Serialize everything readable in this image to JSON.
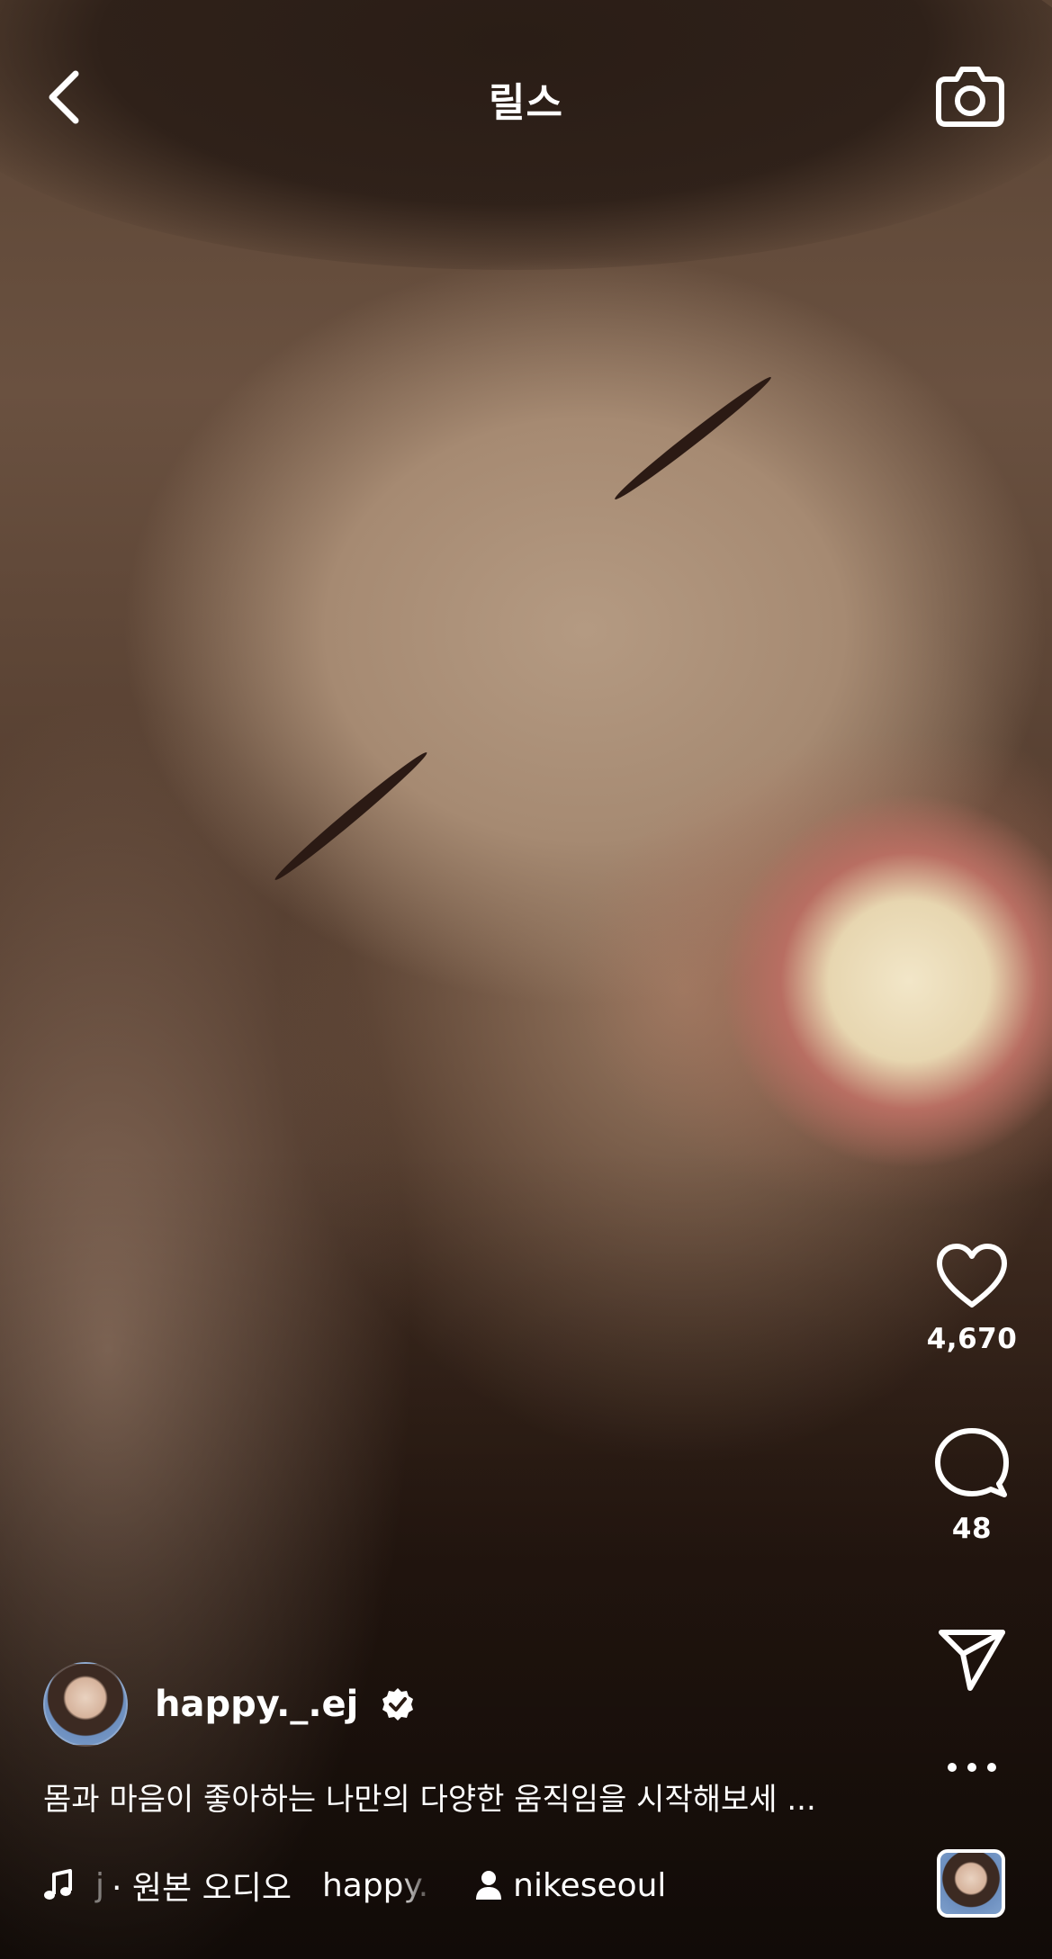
{
  "header": {
    "title": "릴스",
    "back_icon": "chevron-left-icon",
    "camera_icon": "camera-icon"
  },
  "actions": {
    "like": {
      "icon": "heart-icon",
      "count": "4,670"
    },
    "comment": {
      "icon": "comment-bubble-icon",
      "count": "48"
    },
    "share": {
      "icon": "send-icon"
    },
    "more": {
      "icon": "more-horizontal-icon"
    }
  },
  "post": {
    "username": "happy._.ej",
    "verified": true,
    "caption": "몸과 마음이 좋아하는 나만의 다양한 움직임을 시작해보세 ...",
    "audio_prefix": "j",
    "audio_label": "· 원본 오디오",
    "audio_ticker": "happy.",
    "tagged_user": "nikeseoul"
  },
  "colors": {
    "text": "#ffffff",
    "overlay": "#000000"
  }
}
